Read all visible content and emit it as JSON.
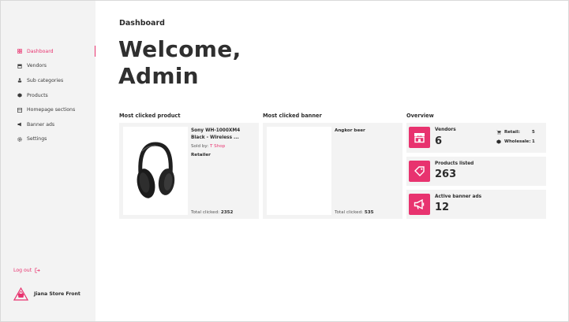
{
  "sidebar": {
    "items": [
      {
        "label": "Dashboard",
        "icon": "dashboard-icon",
        "active": true
      },
      {
        "label": "Vendors",
        "icon": "store-icon"
      },
      {
        "label": "Sub categories",
        "icon": "category-icon"
      },
      {
        "label": "Products",
        "icon": "box-icon"
      },
      {
        "label": "Homepage sections",
        "icon": "layout-icon"
      },
      {
        "label": "Banner ads",
        "icon": "megaphone-icon"
      },
      {
        "label": "Settings",
        "icon": "gear-icon"
      }
    ],
    "logout_label": "Log out",
    "brand_name": "Jiana Store Front"
  },
  "main": {
    "title": "Dashboard",
    "welcome_line1": "Welcome,",
    "welcome_line2": "Admin"
  },
  "most_clicked_product": {
    "section_label": "Most clicked product",
    "name_line1": "Sony WH-1000XM4",
    "name_line2": "Black - Wireless ...",
    "sold_by_label": "Sold by:",
    "seller": "T Shop",
    "seller_type": "Retailer",
    "total_label": "Total clicked:",
    "total_value": "2352"
  },
  "most_clicked_banner": {
    "section_label": "Most clicked banner",
    "name": "Angkor beer",
    "total_label": "Total clicked:",
    "total_value": "535"
  },
  "overview": {
    "section_label": "Overview",
    "vendors": {
      "label": "Vendors",
      "value": "6",
      "retail_label": "Retail:",
      "retail_value": "5",
      "wholesale_label": "Wholesale:",
      "wholesale_value": "1"
    },
    "products": {
      "label": "Products listed",
      "value": "263"
    },
    "banners": {
      "label": "Active banner ads",
      "value": "12"
    }
  },
  "colors": {
    "accent": "#e8336f",
    "panel": "#f3f3f3",
    "text": "#2b2b2b"
  }
}
